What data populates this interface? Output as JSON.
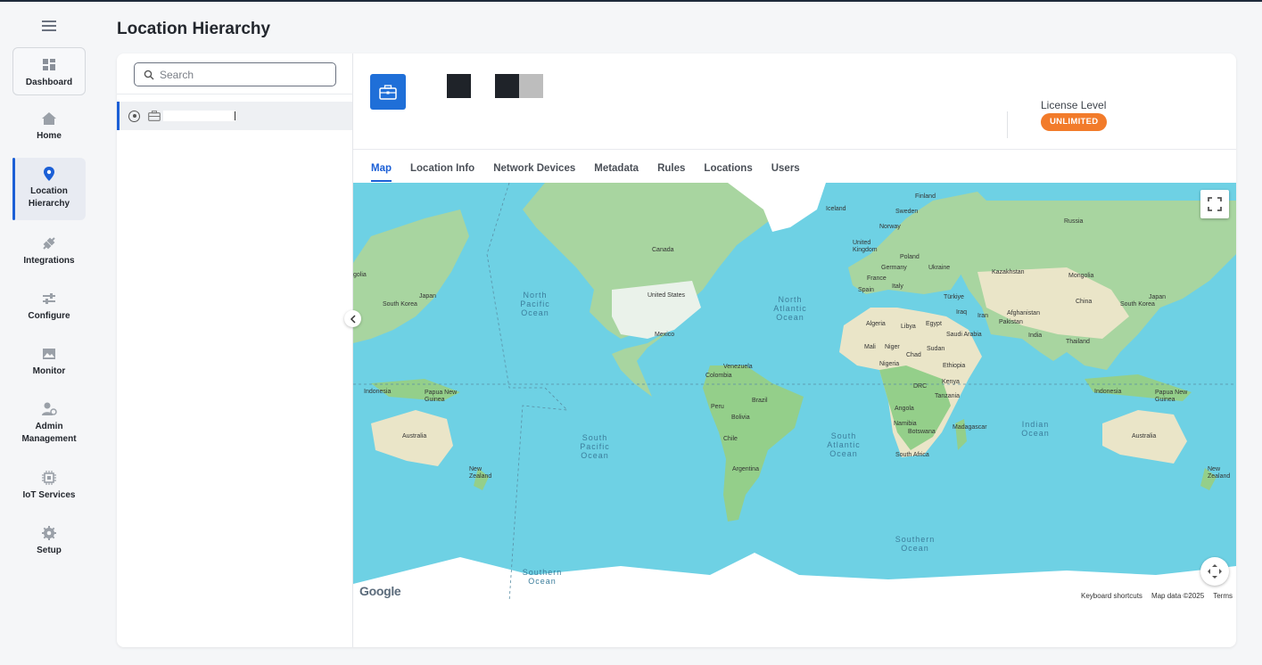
{
  "page": {
    "title": "Location Hierarchy"
  },
  "sidebar": {
    "items": [
      {
        "label": "Dashboard",
        "icon": "dashboard-icon"
      },
      {
        "label": "Home",
        "icon": "home-icon"
      },
      {
        "label": "Location Hierarchy",
        "icon": "location-pin-icon",
        "active": true
      },
      {
        "label": "Integrations",
        "icon": "plug-icon"
      },
      {
        "label": "Configure",
        "icon": "sliders-icon"
      },
      {
        "label": "Monitor",
        "icon": "monitor-icon"
      },
      {
        "label": "Admin Management",
        "icon": "admin-user-icon"
      },
      {
        "label": "IoT Services",
        "icon": "chip-icon"
      },
      {
        "label": "Setup",
        "icon": "gear-icon"
      }
    ]
  },
  "tree": {
    "search_placeholder": "Search"
  },
  "location": {
    "license_label": "License Level",
    "license_value": "UNLIMITED",
    "accent_color": "#1f6fd8",
    "badge_color": "#f27b2a"
  },
  "tabs": [
    {
      "label": "Map",
      "active": true
    },
    {
      "label": "Location Info"
    },
    {
      "label": "Network Devices"
    },
    {
      "label": "Metadata"
    },
    {
      "label": "Rules"
    },
    {
      "label": "Locations"
    },
    {
      "label": "Users"
    }
  ],
  "map": {
    "labels": [
      "Finland",
      "Iceland",
      "Sweden",
      "Norway",
      "Russia",
      "United Kingdom",
      "Poland",
      "Germany",
      "Ukraine",
      "Kazakhstan",
      "France",
      "Italy",
      "Spain",
      "Mongolia",
      "Türkiye",
      "Japan",
      "South Korea",
      "China",
      "Iraq",
      "Iran",
      "Afghanistan",
      "Pakistan",
      "Algeria",
      "Libya",
      "Egypt",
      "Saudi Arabia",
      "India",
      "Thailand",
      "Mali",
      "Niger",
      "Chad",
      "Sudan",
      "Nigeria",
      "Ethiopia",
      "Canada",
      "United States",
      "Mexico",
      "Venezuela",
      "Colombia",
      "Brazil",
      "Peru",
      "Bolivia",
      "Chile",
      "Argentina",
      "DRC",
      "Kenya",
      "Tanzania",
      "Angola",
      "Namibia",
      "Botswana",
      "Madagascar",
      "South Africa",
      "Indonesia",
      "Papua New Guinea",
      "Australia",
      "New Zealand",
      "golia"
    ],
    "oceans": [
      "North Pacific Ocean",
      "North Atlantic Ocean",
      "South Pacific Ocean",
      "South Atlantic Ocean",
      "Indian Ocean",
      "Southern Ocean"
    ],
    "logo": "Google",
    "footer": {
      "shortcuts": "Keyboard shortcuts",
      "data": "Map data ©2025",
      "terms": "Terms"
    }
  }
}
